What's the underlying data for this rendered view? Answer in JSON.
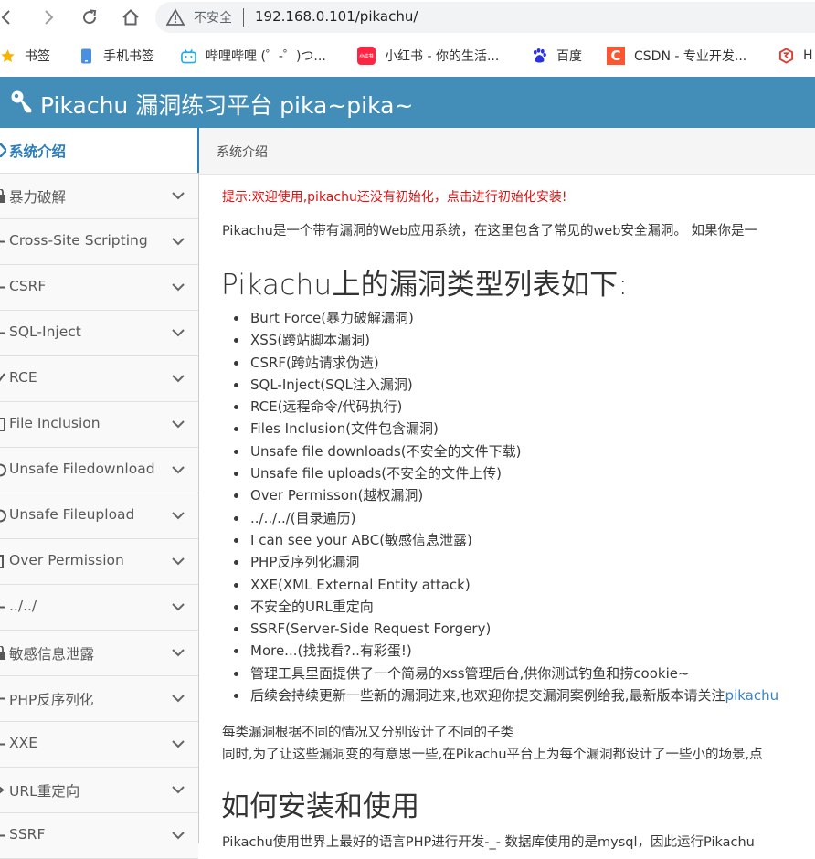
{
  "browser": {
    "security_label": "不安全",
    "url": "192.168.0.101/pikachu/"
  },
  "bookmarks": [
    {
      "icon": "star-icon",
      "label": "书签",
      "color": "#f4b400"
    },
    {
      "icon": "mobile-bookmark-icon",
      "label": "手机书签",
      "color": "#4a90e2"
    },
    {
      "icon": "bilibili-icon",
      "label": "哔哩哔哩 (゜-゜)つ...",
      "color": "#23ade5"
    },
    {
      "icon": "xiaohongshu-icon",
      "label": "小红书 - 你的生活...",
      "color": "#ff2442",
      "badge": "小红书"
    },
    {
      "icon": "baidu-icon",
      "label": "百度",
      "color": "#2932e1"
    },
    {
      "icon": "csdn-icon",
      "label": "CSDN - 专业开发...",
      "color": "#fc5531",
      "badge": "C"
    },
    {
      "icon": "h-site-icon",
      "label": "H",
      "color": "#e03c31"
    }
  ],
  "app": {
    "title": "Pikachu 漏洞练习平台 pika~pika~",
    "accent": "#438eb9"
  },
  "sidebar": {
    "items": [
      {
        "label": "系统介绍",
        "active": true
      },
      {
        "label": "暴力破解"
      },
      {
        "label": "Cross-Site Scripting"
      },
      {
        "label": "CSRF"
      },
      {
        "label": "SQL-Inject"
      },
      {
        "label": "RCE"
      },
      {
        "label": "File Inclusion"
      },
      {
        "label": "Unsafe Filedownload"
      },
      {
        "label": "Unsafe Fileupload"
      },
      {
        "label": "Over Permission"
      },
      {
        "label": "../../"
      },
      {
        "label": "敏感信息泄露"
      },
      {
        "label": "PHP反序列化"
      },
      {
        "label": "XXE"
      },
      {
        "label": "URL重定向"
      },
      {
        "label": "SSRF"
      }
    ]
  },
  "main": {
    "breadcrumb": "系统介绍",
    "notice": "提示:欢迎使用,pikachu还没有初始化，点击进行初始化安装!",
    "intro": "Pikachu是一个带有漏洞的Web应用系统，在这里包含了常见的web安全漏洞。 如果你是一",
    "heading": "Pikachu上的漏洞类型列表如下:",
    "vulns": [
      "Burt Force(暴力破解漏洞)",
      "XSS(跨站脚本漏洞)",
      "CSRF(跨站请求伪造)",
      "SQL-Inject(SQL注入漏洞)",
      "RCE(远程命令/代码执行)",
      "Files Inclusion(文件包含漏洞)",
      "Unsafe file downloads(不安全的文件下载)",
      "Unsafe file uploads(不安全的文件上传)",
      "Over Permisson(越权漏洞)",
      "../../../(目录遍历)",
      "I can see your ABC(敏感信息泄露)",
      "PHP反序列化漏洞",
      "XXE(XML External Entity attack)",
      "不安全的URL重定向",
      "SSRF(Server-Side Request Forgery)",
      "More...(找找看?..有彩蛋!)",
      "管理工具里面提供了一个简易的xss管理后台,供你测试钓鱼和捞cookie~"
    ],
    "last_item_text": "后续会持续更新一些新的漏洞进来,也欢迎你提交漏洞案例给我,最新版本请关注",
    "last_item_link": "pikachu",
    "para1": "每类漏洞根据不同的情况又分别设计了不同的子类",
    "para2": "同时,为了让这些漏洞变的有意思一些,在Pikachu平台上为每个漏洞都设计了一些小的场景,点",
    "heading2": "如何安装和使用",
    "para3": "Pikachu使用世界上最好的语言PHP进行开发-_- 数据库使用的是mysql，因此运行Pikachu"
  }
}
